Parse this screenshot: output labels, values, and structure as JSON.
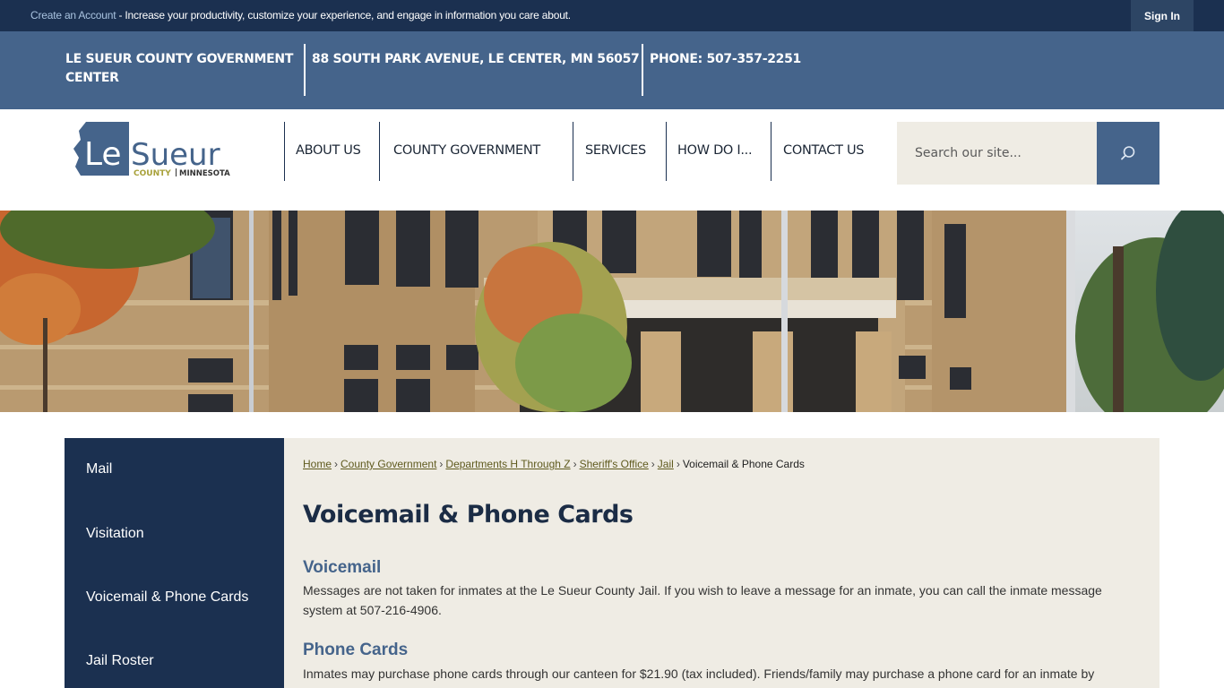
{
  "topbar": {
    "create_account_link": "Create an Account",
    "promo_text": " - Increase your productivity, customize your experience, and engage in information you care about.",
    "sign_in": "Sign In"
  },
  "infoband": {
    "name_line1": "LE SUEUR COUNTY GOVERNMENT",
    "name_line2": "CENTER",
    "address": "88 SOUTH PARK AVENUE, LE CENTER, MN 56057",
    "phone": "PHONE: 507-357-2251"
  },
  "logo": {
    "word1": "Le",
    "word2": "Sueur",
    "county": "COUNTY",
    "state": "MINNESOTA"
  },
  "nav": {
    "items": [
      {
        "label": "ABOUT US"
      },
      {
        "label": "COUNTY GOVERNMENT"
      },
      {
        "label": "SERVICES"
      },
      {
        "label": "HOW DO I..."
      },
      {
        "label": "CONTACT US"
      }
    ]
  },
  "search": {
    "placeholder": "Search our site...",
    "icon": "search-icon"
  },
  "hero": {
    "alt": "Le Sueur County Courthouse in autumn"
  },
  "sidebar": {
    "items": [
      {
        "label": "Mail"
      },
      {
        "label": "Visitation"
      },
      {
        "label": "Voicemail & Phone Cards"
      },
      {
        "label": "Jail Roster"
      }
    ]
  },
  "breadcrumb": {
    "items": [
      {
        "label": "Home"
      },
      {
        "label": "County Government"
      },
      {
        "label": "Departments H Through Z"
      },
      {
        "label": "Sheriff's Office"
      },
      {
        "label": "Jail"
      }
    ],
    "current": "Voicemail & Phone Cards",
    "separator": "›"
  },
  "page": {
    "title": "Voicemail & Phone Cards",
    "sections": [
      {
        "heading": "Voicemail",
        "body": "Messages are not taken for inmates at the Le Sueur County Jail. If you wish to leave a message for an inmate, you can call the inmate message system at 507-216-4906."
      },
      {
        "heading": "Phone Cards",
        "body": "Inmates may purchase phone cards through our canteen for $21.90 (tax included). Friends/family may purchase a phone card for an inmate by"
      }
    ]
  },
  "colors": {
    "navy": "#1b3050",
    "slate_blue": "#45648b",
    "cream": "#efece4",
    "olive_link": "#5f5a1e",
    "logo_gold": "#a8a13a"
  }
}
